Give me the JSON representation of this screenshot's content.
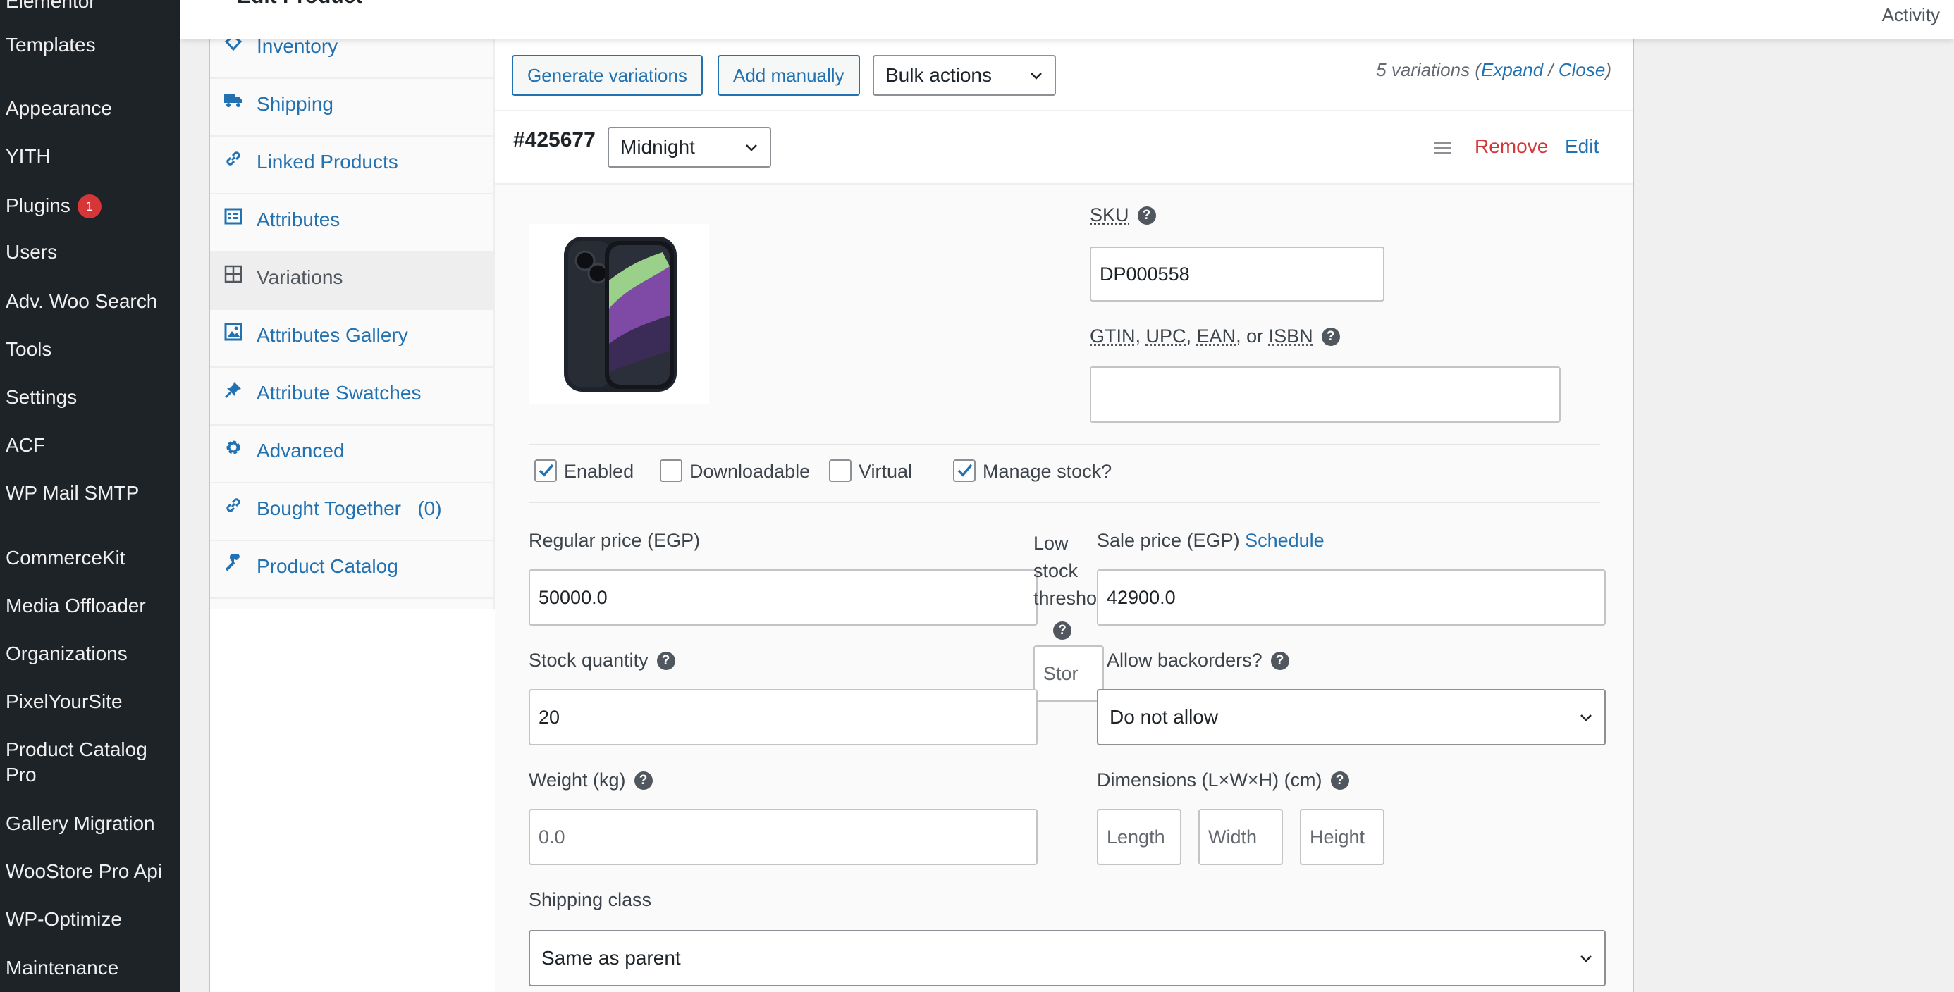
{
  "sidebar": {
    "items": [
      {
        "label": "Elementor"
      },
      {
        "label": "Templates"
      },
      {
        "label": "Appearance"
      },
      {
        "label": "YITH"
      },
      {
        "label": "Plugins",
        "badge": "1"
      },
      {
        "label": "Users"
      },
      {
        "label": "Adv. Woo Search"
      },
      {
        "label": "Tools"
      },
      {
        "label": "Settings"
      },
      {
        "label": "ACF"
      },
      {
        "label": "WP Mail SMTP"
      },
      {
        "label": "CommerceKit"
      },
      {
        "label": "Media Offloader"
      },
      {
        "label": "Organizations"
      },
      {
        "label": "PixelYourSite"
      },
      {
        "label": "Product Catalog Pro"
      },
      {
        "label": "Gallery Migration"
      },
      {
        "label": "WooStore Pro Api"
      },
      {
        "label": "WP-Optimize"
      },
      {
        "label": "Maintenance"
      }
    ]
  },
  "header": {
    "title": "Edit Product",
    "activity": "Activity"
  },
  "tabs": [
    {
      "label": "Inventory",
      "icon": "diamond-icon"
    },
    {
      "label": "Shipping",
      "icon": "truck-icon"
    },
    {
      "label": "Linked Products",
      "icon": "link-icon"
    },
    {
      "label": "Attributes",
      "icon": "list-icon"
    },
    {
      "label": "Variations",
      "icon": "grid-icon",
      "active": true
    },
    {
      "label": "Attributes Gallery",
      "icon": "image-icon"
    },
    {
      "label": "Attribute Swatches",
      "icon": "pin-icon"
    },
    {
      "label": "Advanced",
      "icon": "gear-icon"
    },
    {
      "label": "Bought Together   (0)",
      "icon": "link-icon"
    },
    {
      "label": "Product Catalog",
      "icon": "wrench-icon"
    }
  ],
  "toolbar": {
    "generate_label": "Generate variations",
    "add_manually_label": "Add manually",
    "bulk_actions_value": "Bulk actions",
    "variation_count": "5 variations (",
    "expand_label": "Expand",
    "separator": " / ",
    "close_label": "Close",
    "close_paren": ")"
  },
  "variation": {
    "id": "#425677",
    "color_value": "Midnight",
    "remove_label": "Remove",
    "edit_label": "Edit",
    "sku_label": "SKU",
    "sku_value": "DP000558",
    "gtin_label": {
      "gtin": "GTIN",
      "upc": "UPC",
      "ean": "EAN",
      "or": ", or ",
      "isbn": "ISBN",
      "sep": ", "
    },
    "gtin_value": "",
    "checkboxes": {
      "enabled": {
        "label": "Enabled",
        "checked": true
      },
      "downloadable": {
        "label": "Downloadable",
        "checked": false
      },
      "virtual": {
        "label": "Virtual",
        "checked": false
      },
      "manage_stock": {
        "label": "Manage stock?",
        "checked": true
      }
    },
    "regular_price_label": "Regular price (EGP)",
    "regular_price_value": "50000.0",
    "low_stock_label": "Low stock threshold",
    "low_stock_placeholder": "Stor",
    "sale_price_label": "Sale price (EGP)",
    "schedule_label": "Schedule",
    "sale_price_value": "42900.0",
    "stock_qty_label": "Stock quantity",
    "stock_qty_value": "20",
    "backorders_label": "Allow backorders?",
    "backorders_value": "Do not allow",
    "weight_label": "Weight (kg)",
    "weight_placeholder": "0.0",
    "dimensions_label": "Dimensions (L×W×H) (cm)",
    "length_placeholder": "Length",
    "width_placeholder": "Width",
    "height_placeholder": "Height",
    "shipping_class_label": "Shipping class",
    "shipping_class_value": "Same as parent"
  }
}
